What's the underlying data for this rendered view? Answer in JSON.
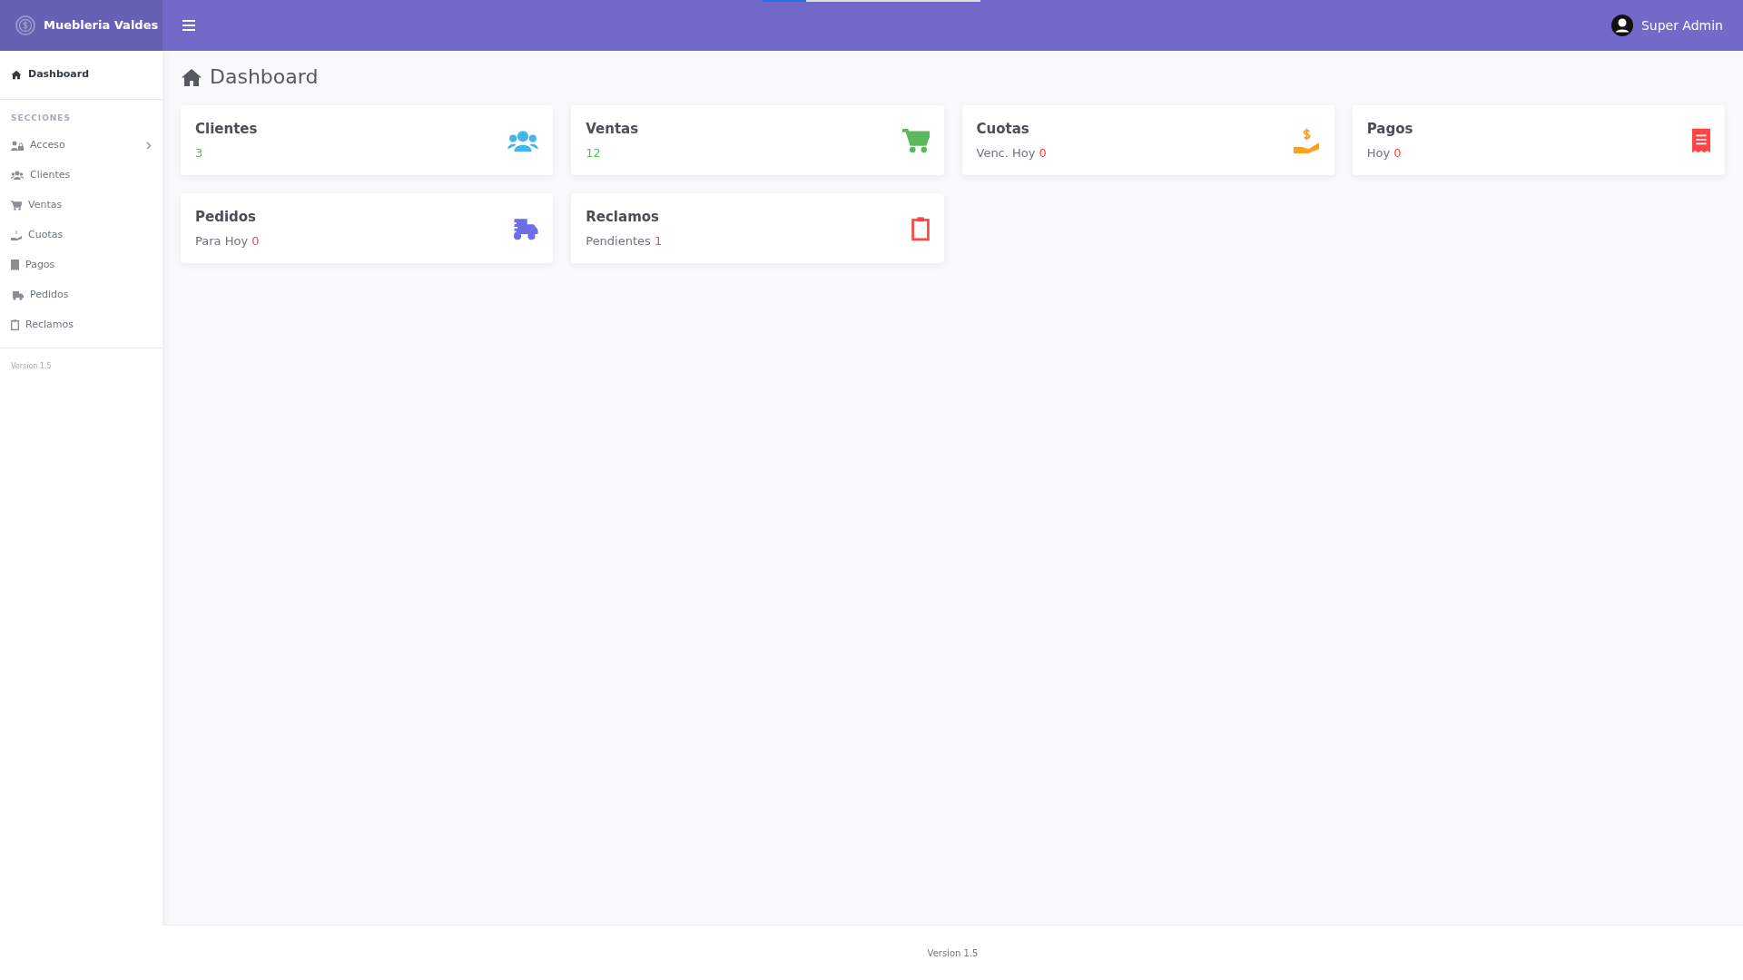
{
  "brand": {
    "title": "Muebleria Valdes"
  },
  "loading_bar": {
    "level": 0.2
  },
  "user": {
    "name": "Super Admin"
  },
  "sidebar": {
    "top_items": [
      {
        "label": "Dashboard",
        "selected": true
      }
    ],
    "section_title": "SECCIONES",
    "items": [
      {
        "label": "Acceso",
        "selected": false,
        "expanded": false
      },
      {
        "label": "Clientes",
        "selected": false
      },
      {
        "label": "Ventas",
        "selected": false
      },
      {
        "label": "Cuotas",
        "selected": false
      },
      {
        "label": "Pagos",
        "selected": false
      },
      {
        "label": "Pedidos",
        "selected": false
      },
      {
        "label": "Reclamos",
        "selected": false
      }
    ],
    "version": "Version 1.5"
  },
  "page_title": "Dashboard",
  "cards": [
    {
      "title": "Clientes",
      "kind": "total",
      "value": "3"
    },
    {
      "title": "Ventas",
      "kind": "total",
      "value": "12"
    },
    {
      "title": "Cuotas",
      "kind": "pending",
      "caption": "Venc. Hoy",
      "value": "0"
    },
    {
      "title": "Pagos",
      "kind": "pending",
      "caption": "Hoy",
      "value": "0"
    },
    {
      "title": "Pedidos",
      "kind": "pending",
      "caption": "Para Hoy",
      "value": "0"
    },
    {
      "title": "Reclamos",
      "kind": "pending",
      "caption": "Pendientes",
      "value": "1"
    }
  ],
  "footer": {
    "text": "Version 1.5"
  }
}
